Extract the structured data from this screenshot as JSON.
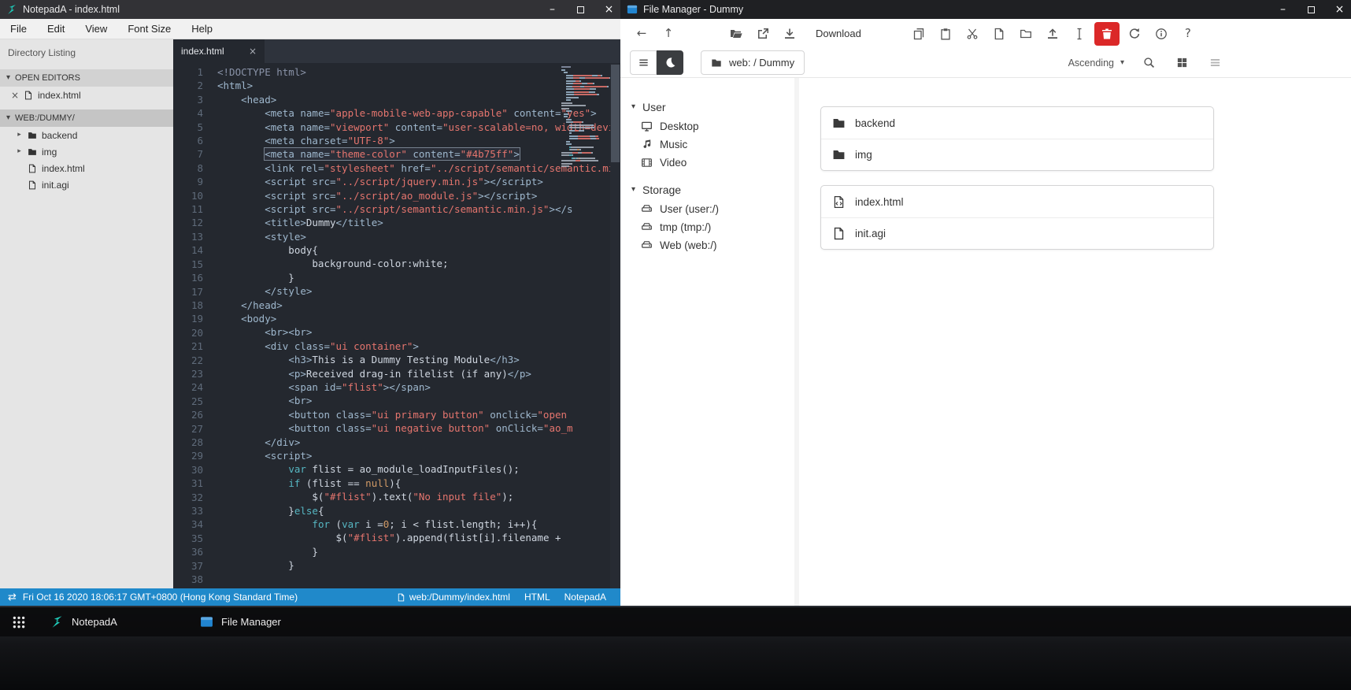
{
  "colors": {
    "statusbar_blue": "#2089ca",
    "danger_red": "#db2828",
    "accent_teal": "#1fc8b7",
    "accent_blue": "#2185d0"
  },
  "notepada": {
    "title": "NotepadA - index.html",
    "menu": [
      "File",
      "Edit",
      "View",
      "Font Size",
      "Help"
    ],
    "sidebar_title": "Directory Listing",
    "open_editors_label": "OPEN EDITORS",
    "workspace_label": "WEB:/DUMMY/",
    "open_editors": [
      {
        "name": "index.html"
      }
    ],
    "workspace_items": [
      {
        "name": "backend",
        "icon": "folder",
        "chevron": true
      },
      {
        "name": "img",
        "icon": "folder",
        "chevron": true
      },
      {
        "name": "index.html",
        "icon": "file",
        "chevron": false
      },
      {
        "name": "init.agi",
        "icon": "file",
        "chevron": false
      }
    ],
    "active_tab": "index.html",
    "highlight_line": 7,
    "code_lines": [
      [
        [
          "c5",
          "<!DOCTYPE html>"
        ]
      ],
      [
        [
          "c1",
          "<html>"
        ]
      ],
      [
        [
          "c0",
          "    "
        ],
        [
          "c1",
          "<head>"
        ]
      ],
      [
        [
          "c0",
          "        "
        ],
        [
          "c1",
          "<meta name="
        ],
        [
          "c2",
          "\"apple-mobile-web-app-capable\""
        ],
        [
          "c1",
          " content="
        ],
        [
          "c2",
          "\"yes\""
        ],
        [
          "c1",
          ">"
        ]
      ],
      [
        [
          "c0",
          "        "
        ],
        [
          "c1",
          "<meta name="
        ],
        [
          "c2",
          "\"viewport\""
        ],
        [
          "c1",
          " content="
        ],
        [
          "c2",
          "\"user-scalable=no, width=device-width\""
        ],
        [
          "c1",
          ">"
        ]
      ],
      [
        [
          "c0",
          "        "
        ],
        [
          "c1",
          "<meta charset="
        ],
        [
          "c2",
          "\"UTF-8\""
        ],
        [
          "c1",
          ">"
        ]
      ],
      [
        [
          "c0",
          "        "
        ],
        [
          "c1",
          "<meta name="
        ],
        [
          "c2",
          "\"theme-color\""
        ],
        [
          "c1",
          " content="
        ],
        [
          "c2",
          "\"#4b75ff\""
        ],
        [
          "c1",
          ">"
        ]
      ],
      [
        [
          "c0",
          "        "
        ],
        [
          "c1",
          "<link rel="
        ],
        [
          "c2",
          "\"stylesheet\""
        ],
        [
          "c1",
          " href="
        ],
        [
          "c2",
          "\"../script/semantic/semantic.min.css\""
        ],
        [
          "c1",
          ">"
        ]
      ],
      [
        [
          "c0",
          "        "
        ],
        [
          "c1",
          "<script src="
        ],
        [
          "c2",
          "\"../script/jquery.min.js\""
        ],
        [
          "c1",
          "></script>"
        ]
      ],
      [
        [
          "c0",
          "        "
        ],
        [
          "c1",
          "<script src="
        ],
        [
          "c2",
          "\"../script/ao_module.js\""
        ],
        [
          "c1",
          "></script>"
        ]
      ],
      [
        [
          "c0",
          "        "
        ],
        [
          "c1",
          "<script src="
        ],
        [
          "c2",
          "\"../script/semantic/semantic.min.js\""
        ],
        [
          "c1",
          "></s"
        ]
      ],
      [
        [
          "c0",
          "        "
        ],
        [
          "c1",
          "<title>"
        ],
        [
          "c0",
          "Dummy"
        ],
        [
          "c1",
          "</title>"
        ]
      ],
      [
        [
          "c0",
          "        "
        ],
        [
          "c1",
          "<style>"
        ]
      ],
      [
        [
          "c0",
          "            body{"
        ]
      ],
      [
        [
          "c0",
          "                background-color:white;"
        ]
      ],
      [
        [
          "c0",
          "            }"
        ]
      ],
      [
        [
          "c0",
          "        "
        ],
        [
          "c1",
          "</style>"
        ]
      ],
      [
        [
          "c0",
          "    "
        ],
        [
          "c1",
          "</head>"
        ]
      ],
      [
        [
          "c0",
          "    "
        ],
        [
          "c1",
          "<body>"
        ]
      ],
      [
        [
          "c0",
          "        "
        ],
        [
          "c1",
          "<br><br>"
        ]
      ],
      [
        [
          "c0",
          "        "
        ],
        [
          "c1",
          "<div class="
        ],
        [
          "c2",
          "\"ui container\""
        ],
        [
          "c1",
          ">"
        ]
      ],
      [
        [
          "c0",
          "            "
        ],
        [
          "c1",
          "<h3>"
        ],
        [
          "c0",
          "This is a Dummy Testing Module"
        ],
        [
          "c1",
          "</h3>"
        ]
      ],
      [
        [
          "c0",
          "            "
        ],
        [
          "c1",
          "<p>"
        ],
        [
          "c0",
          "Received drag-in filelist (if any)"
        ],
        [
          "c1",
          "</p>"
        ]
      ],
      [
        [
          "c0",
          "            "
        ],
        [
          "c1",
          "<span id="
        ],
        [
          "c2",
          "\"flist\""
        ],
        [
          "c1",
          "></span>"
        ]
      ],
      [
        [
          "c0",
          "            "
        ],
        [
          "c1",
          "<br>"
        ]
      ],
      [
        [
          "c0",
          "            "
        ],
        [
          "c1",
          "<button class="
        ],
        [
          "c2",
          "\"ui primary button\""
        ],
        [
          "c1",
          " onclick="
        ],
        [
          "c2",
          "\"open"
        ]
      ],
      [
        [
          "c0",
          "            "
        ],
        [
          "c1",
          "<button class="
        ],
        [
          "c2",
          "\"ui negative button\""
        ],
        [
          "c1",
          " onClick="
        ],
        [
          "c2",
          "\"ao_m"
        ]
      ],
      [
        [
          "c0",
          "        "
        ],
        [
          "c1",
          "</div>"
        ]
      ],
      [
        [
          "c0",
          "        "
        ],
        [
          "c1",
          "<script>"
        ]
      ],
      [
        [
          "c0",
          "            "
        ],
        [
          "c3",
          "var"
        ],
        [
          "c0",
          " flist = ao_module_loadInputFiles();"
        ]
      ],
      [
        [
          "c0",
          "            "
        ],
        [
          "c3",
          "if"
        ],
        [
          "c0",
          " (flist == "
        ],
        [
          "c4",
          "null"
        ],
        [
          "c0",
          "){"
        ]
      ],
      [
        [
          "c0",
          "                $("
        ],
        [
          "c2",
          "\"#flist\""
        ],
        [
          "c0",
          ").text("
        ],
        [
          "c2",
          "\"No input file\""
        ],
        [
          "c0",
          ");"
        ]
      ],
      [
        [
          "c0",
          "            }"
        ],
        [
          "c3",
          "else"
        ],
        [
          "c0",
          "{"
        ]
      ],
      [
        [
          "c0",
          "                "
        ],
        [
          "c3",
          "for"
        ],
        [
          "c0",
          " ("
        ],
        [
          "c3",
          "var"
        ],
        [
          "c0",
          " i ="
        ],
        [
          "c4",
          "0"
        ],
        [
          "c0",
          "; i < flist.length; i++){"
        ]
      ],
      [
        [
          "c0",
          "                    $("
        ],
        [
          "c2",
          "\"#flist\""
        ],
        [
          "c0",
          ").append(flist[i].filename + "
        ]
      ],
      [
        [
          "c0",
          "                }"
        ]
      ],
      [
        [
          "c0",
          "            }"
        ]
      ],
      [
        [
          "c0",
          ""
        ]
      ]
    ],
    "statusbar": {
      "datetime": "Fri Oct 16 2020 18:06:17 GMT+0800 (Hong Kong Standard Time)",
      "file_path": "web:/Dummy/index.html",
      "language": "HTML",
      "app_name": "NotepadA"
    }
  },
  "filemanager": {
    "title": "File Manager - Dummy",
    "download_label": "Download",
    "breadcrumb": "web: / Dummy",
    "sort_label": "Ascending",
    "sidebar": [
      {
        "section": "User",
        "items": [
          {
            "name": "Desktop",
            "icon": "desktop"
          },
          {
            "name": "Music",
            "icon": "music"
          },
          {
            "name": "Video",
            "icon": "video"
          }
        ]
      },
      {
        "section": "Storage",
        "items": [
          {
            "name": "User (user:/)",
            "icon": "drive"
          },
          {
            "name": "tmp (tmp:/)",
            "icon": "drive"
          },
          {
            "name": "Web (web:/)",
            "icon": "drive"
          }
        ]
      }
    ],
    "file_groups": [
      {
        "items": [
          {
            "name": "backend",
            "icon": "folder-solid"
          },
          {
            "name": "img",
            "icon": "folder-solid"
          }
        ]
      },
      {
        "items": [
          {
            "name": "index.html",
            "icon": "file-code"
          },
          {
            "name": "init.agi",
            "icon": "file-outline"
          }
        ]
      }
    ]
  },
  "taskbar": {
    "items": [
      {
        "label": "NotepadA",
        "icon": "np-logo"
      },
      {
        "label": "File Manager",
        "icon": "fm-logo"
      }
    ]
  }
}
